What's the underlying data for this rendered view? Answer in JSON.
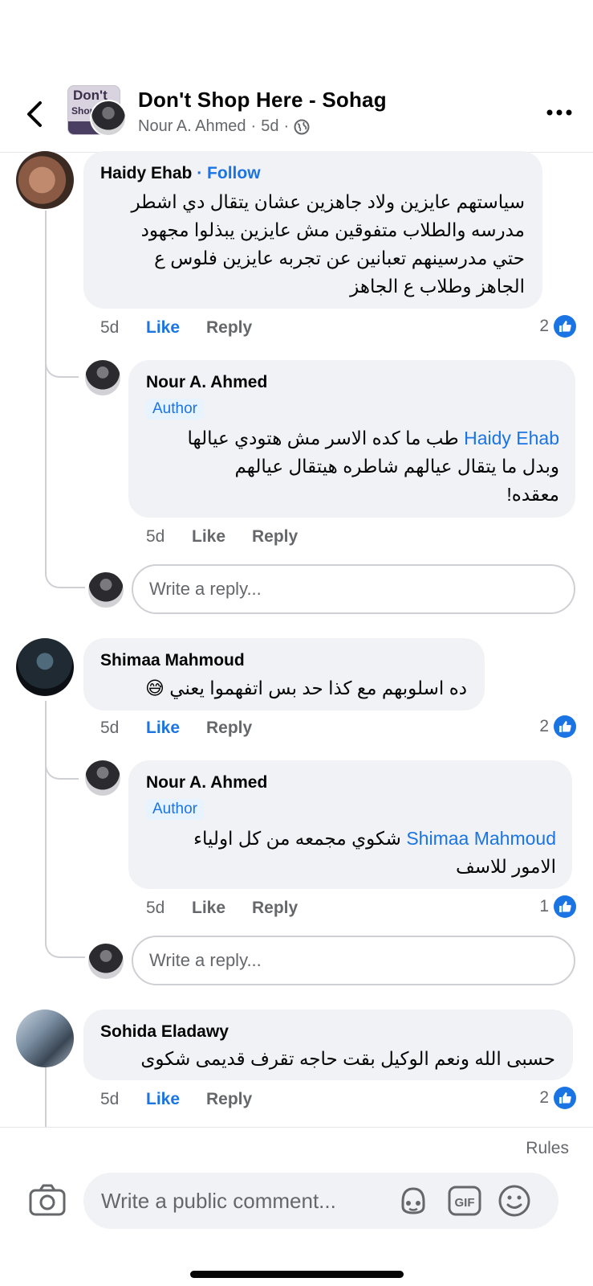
{
  "header": {
    "title": "Don't Shop Here - Sohag",
    "subtitle_author": "Nour A. Ahmed",
    "subtitle_time": "5d",
    "thumb_text_1": "Don't",
    "thumb_text_2": "Shop"
  },
  "comments": [
    {
      "name": "Haidy Ehab",
      "follow_label": "· Follow",
      "text_lines": [
        "سياستهم عايزين ولاد جاهزين عشان يتقال دي اشطر",
        "مدرسه والطلاب متفوقين مش عايزين يبذلوا مجهود",
        "حتي مدرسينهم تعبانين عن تجربه عايزين فلوس ع",
        "الجاهز وطلاب ع الجاهز"
      ],
      "time": "5d",
      "like": "Like",
      "reply": "Reply",
      "reactions": "2"
    },
    {
      "name": "Shimaa Mahmoud",
      "text_lines": [
        "ده اسلوبهم مع كذا حد بس اتفهموا يعني 😅"
      ],
      "time": "5d",
      "like": "Like",
      "reply": "Reply",
      "reactions": "2"
    },
    {
      "name": "Sohida Eladawy",
      "text_lines": [
        "حسبى الله ونعم الوكيل بقت حاجه تقرف  قديمى شكوى"
      ],
      "time": "5d",
      "like": "Like",
      "reply": "Reply",
      "reactions": "2"
    }
  ],
  "replies": [
    {
      "name": "Nour A. Ahmed",
      "badge": "Author",
      "mention": "Haidy Ehab",
      "line1_rest": "طب ما كده الاسر مش هتودي عيالها",
      "line2": "وبدل ما يتقال عيالهم شاطره هيتقال عيالهم",
      "line3": "معقده!",
      "time": "5d",
      "like": "Like",
      "reply": "Reply"
    },
    {
      "name": "Nour A. Ahmed",
      "badge": "Author",
      "mention": "Shimaa Mahmoud",
      "line1_rest": "شكوي مجمعه من كل اولياء",
      "line2": "الامور للاسف",
      "time": "5d",
      "like": "Like",
      "reply": "Reply",
      "reactions": "1"
    }
  ],
  "reply_placeholder": "Write a reply...",
  "footer": {
    "rules": "Rules",
    "composer_placeholder": "Write a public comment..."
  },
  "colors": {
    "accent": "#1b74e4",
    "bubble": "#f0f2f5",
    "secondary_text": "#65676b"
  },
  "icons": [
    "back-arrow-icon",
    "globe-icon",
    "more-icon",
    "like-icon",
    "camera-icon",
    "avatar-sticker-icon",
    "gif-icon",
    "emoji-icon"
  ]
}
